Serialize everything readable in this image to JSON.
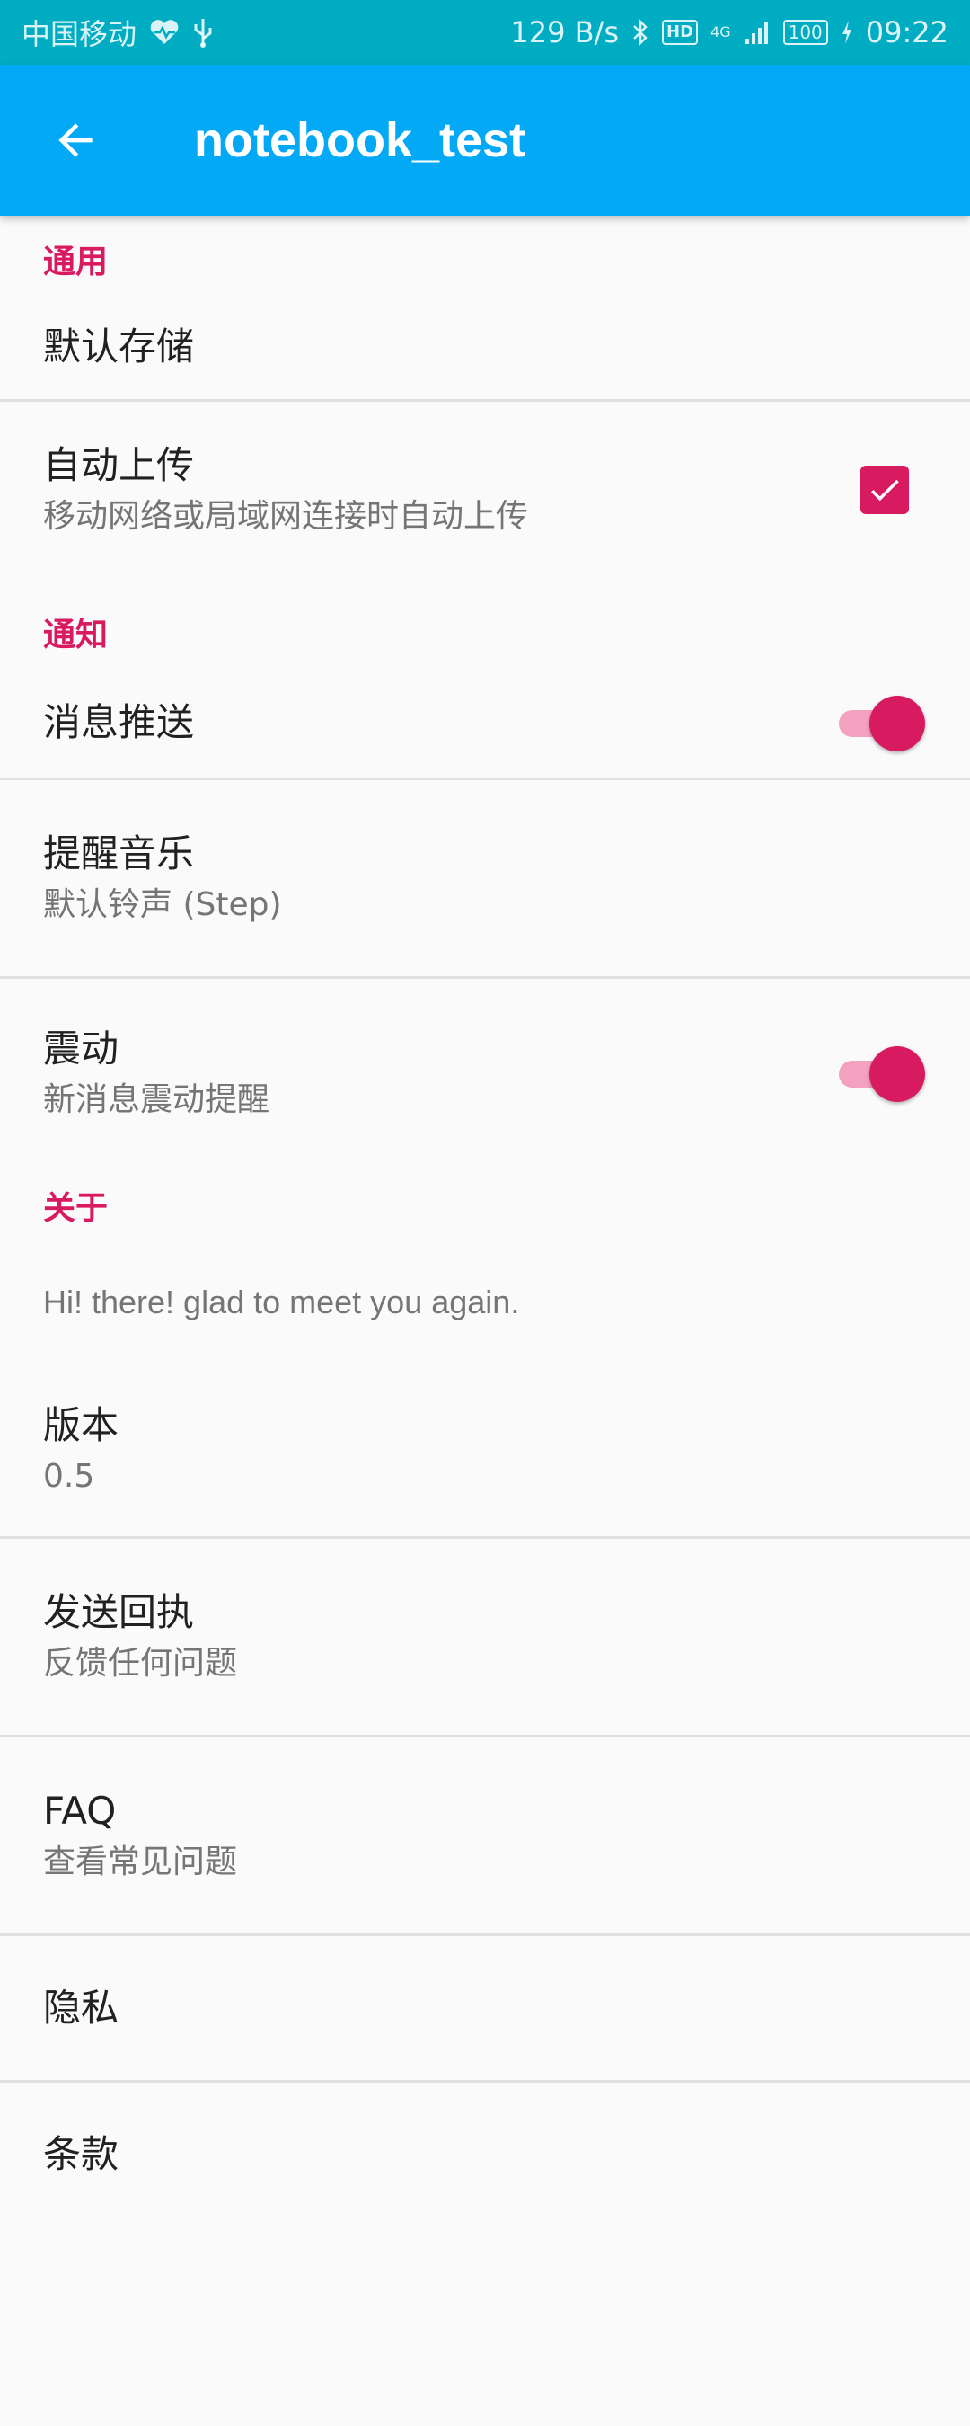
{
  "status_bar": {
    "carrier": "中国移动",
    "speed": "129 B/s",
    "network": "4G",
    "hd": "HD",
    "battery": "100",
    "time": "09:22"
  },
  "app_bar": {
    "title": "notebook_test"
  },
  "sections": {
    "general": {
      "header": "通用",
      "default_storage": {
        "title": "默认存储"
      },
      "auto_upload": {
        "title": "自动上传",
        "summary": "移动网络或局域网连接时自动上传",
        "checked": true
      }
    },
    "notifications": {
      "header": "通知",
      "push": {
        "title": "消息推送",
        "enabled": true
      },
      "ringtone": {
        "title": "提醒音乐",
        "summary": "默认铃声 (Step)"
      },
      "vibrate": {
        "title": "震动",
        "summary": "新消息震动提醒",
        "enabled": true
      }
    },
    "about": {
      "header": "关于",
      "message": "Hi! there! glad to meet you again.",
      "version": {
        "title": "版本",
        "summary": "0.5"
      },
      "feedback": {
        "title": "发送回执",
        "summary": "反馈任何问题"
      },
      "faq": {
        "title": "FAQ",
        "summary": "查看常见问题"
      },
      "privacy": {
        "title": "隐私"
      },
      "terms": {
        "title": "条款"
      }
    }
  },
  "colors": {
    "status_bar": "#00acc1",
    "app_bar": "#03a9f4",
    "accent": "#d81b60",
    "background": "#fafafa"
  }
}
